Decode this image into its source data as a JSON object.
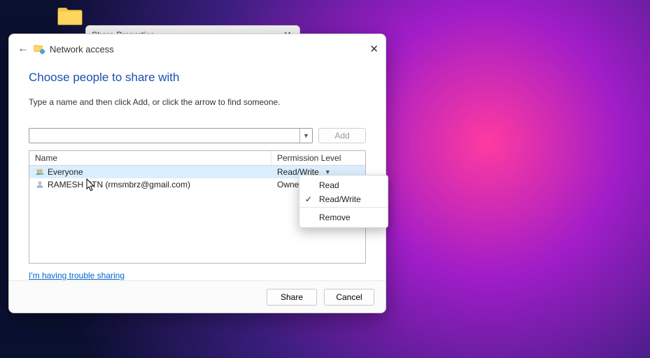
{
  "desktop": {
    "folder_label": ""
  },
  "bg_window": {
    "title": "Share Properties"
  },
  "dialog": {
    "title": "Network access",
    "heading": "Choose people to share with",
    "sub": "Type a name and then click Add, or click the arrow to find someone.",
    "add_btn": "Add",
    "table": {
      "col_name": "Name",
      "col_perm": "Permission Level",
      "rows": [
        {
          "name": "Everyone",
          "perm": "Read/Write",
          "selected": true,
          "icon": "group-icon",
          "has_drop": true
        },
        {
          "name": "RAMESH RTN (rmsmbrz@gmail.com)",
          "perm": "Owner",
          "selected": false,
          "icon": "user-icon",
          "has_drop": false
        }
      ]
    },
    "help_link": "I'm having trouble sharing",
    "footer": {
      "share": "Share",
      "cancel": "Cancel"
    }
  },
  "ctx": {
    "items": [
      {
        "label": "Read",
        "checked": false
      },
      {
        "label": "Read/Write",
        "checked": true
      },
      {
        "label": "Remove",
        "checked": false
      }
    ]
  }
}
